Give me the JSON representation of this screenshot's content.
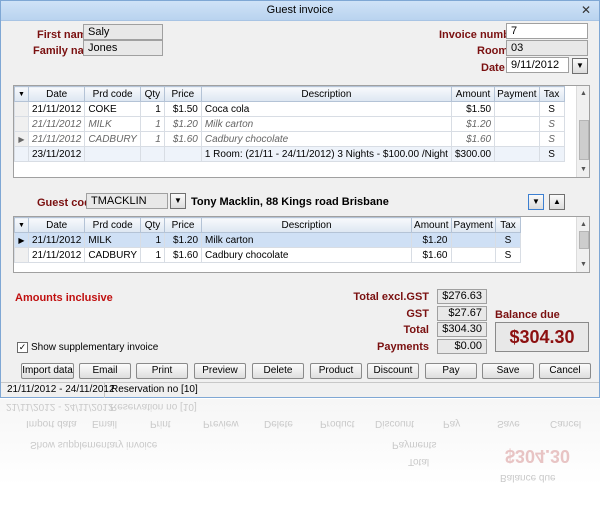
{
  "window": {
    "title": "Guest invoice",
    "close_glyph": "✕"
  },
  "guest": {
    "first_name_label": "First name",
    "first_name": "Saly",
    "family_name_label": "Family name",
    "family_name": "Jones"
  },
  "invoice": {
    "number_label": "Invoice number",
    "number": "7",
    "room_label": "Room",
    "room": "03",
    "date_label": "Date",
    "date": "9/11/2012"
  },
  "grid1": {
    "columns": [
      "Date",
      "Prd code",
      "Qty",
      "Price",
      "Description",
      "Amount",
      "Payment",
      "Tax"
    ],
    "rows": [
      [
        "21/11/2012",
        "COKE",
        "1",
        "$1.50",
        "Coca cola",
        "$1.50",
        "",
        "S"
      ],
      [
        "21/11/2012",
        "MILK",
        "1",
        "$1.20",
        "Milk carton",
        "$1.20",
        "",
        "S"
      ],
      [
        "21/11/2012",
        "CADBURY",
        "1",
        "$1.60",
        "Cadbury chocolate",
        "$1.60",
        "",
        "S"
      ],
      [
        "23/11/2012",
        "",
        "",
        "",
        "1 Room: (21/11 - 24/11/2012) 3 Nights - $100.00 /Night",
        "$300.00",
        "",
        "S"
      ]
    ]
  },
  "guest_code": {
    "label": "Guest code",
    "code": "TMACKLIN",
    "guest_info": "Tony Macklin, 88 Kings road Brisbane"
  },
  "grid2": {
    "columns": [
      "Date",
      "Prd code",
      "Qty",
      "Price",
      "Description",
      "Amount",
      "Payment",
      "Tax"
    ],
    "rows": [
      [
        "21/11/2012",
        "MILK",
        "1",
        "$1.20",
        "Milk carton",
        "$1.20",
        "",
        "S"
      ],
      [
        "21/11/2012",
        "CADBURY",
        "1",
        "$1.60",
        "Cadbury chocolate",
        "$1.60",
        "",
        "S"
      ]
    ]
  },
  "totals": {
    "amounts_label": "Amounts  inclusive",
    "total_excl_label": "Total excl.GST",
    "total_excl": "$276.63",
    "gst_label": "GST",
    "gst": "$27.67",
    "total_label": "Total",
    "total": "$304.30",
    "payments_label": "Payments",
    "payments": "$0.00",
    "balance_label": "Balance due",
    "balance": "$304.30"
  },
  "supplementary": {
    "label": "Show supplementary invoice",
    "checked": "✓"
  },
  "buttons": {
    "import_data": "Import data",
    "email": "Email",
    "print": "Print",
    "preview": "Preview",
    "delete": "Delete",
    "product": "Product",
    "discount": "Discount",
    "pay": "Pay",
    "save": "Save",
    "cancel": "Cancel"
  },
  "status": {
    "period": "21/11/2012 - 24/11/2012",
    "reservation": "Reservation no [10]"
  },
  "icons": {
    "dropdown": "▼",
    "up": "▲",
    "row_pointer": "▶",
    "scroll_up": "▲",
    "scroll_down": "▼"
  },
  "colors": {
    "label_accent": "#7a1010",
    "balance": "#8c1010",
    "selected_row": "#cfe0f5"
  }
}
